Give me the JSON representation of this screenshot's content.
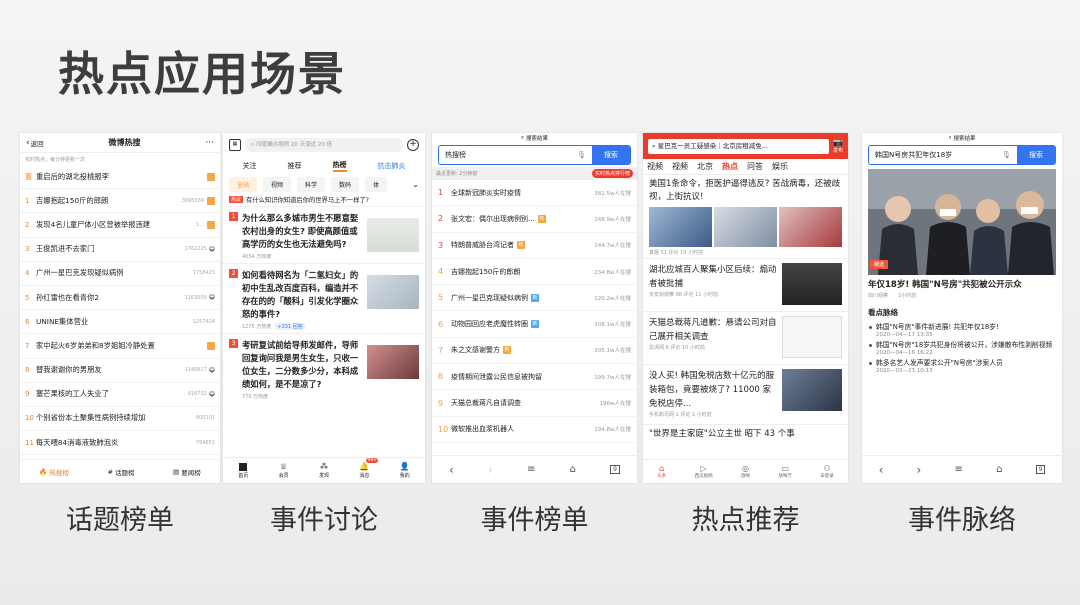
{
  "slide_title": "热点应用场景",
  "captions": [
    "话题榜单",
    "事件讨论",
    "事件榜单",
    "热点推荐",
    "事件脉络"
  ],
  "accent_colors": {
    "weibo": "#f2831f",
    "baidu": "#3375f1",
    "news_red": "#eb3c2b"
  },
  "weibo": {
    "back_label": "返回",
    "title": "微博热搜",
    "subtitle": "实时热点，每分钟更新一次",
    "items": [
      {
        "rank": "置",
        "title": "重启后的湖北投桃报李",
        "heat": "",
        "tag": true
      },
      {
        "rank": "1",
        "title": "吉娜抱起150斤的郎朗",
        "heat": "3095569",
        "tag": true
      },
      {
        "rank": "2",
        "title": "发现4名儿童尸体小区曾被举报违建",
        "heat": "1...",
        "tag": true
      },
      {
        "rank": "3",
        "title": "王俊凯进不去家门",
        "heat": "1762225",
        "tag": false,
        "emoji": "😄"
      },
      {
        "rank": "4",
        "title": "广州一星巴克发现疑似病例",
        "heat": "1758423",
        "tag": false
      },
      {
        "rank": "5",
        "title": "孙红雷也在看青你2",
        "heat": "1263059",
        "tag": false,
        "emoji": "😄"
      },
      {
        "rank": "6",
        "title": "UNINE集体营业",
        "heat": "1257424",
        "tag": false
      },
      {
        "rank": "7",
        "title": "家中起火6岁弟弟和8岁姐姐冷静处置",
        "heat": "",
        "tag": true
      },
      {
        "rank": "8",
        "title": "替我谢谢你的男朋友",
        "heat": "1140817",
        "tag": false,
        "emoji": "😄"
      },
      {
        "rank": "9",
        "title": "塞芒果核的工人失业了",
        "heat": "916732",
        "tag": false,
        "emoji": "😄"
      },
      {
        "rank": "10",
        "title": "个别省份本土聚集性病例持续增加",
        "heat": "800101",
        "tag": false
      },
      {
        "rank": "11",
        "title": "每天喂84消毒液致肺泡炎",
        "heat": "764651",
        "tag": false
      }
    ],
    "footer": [
      "热搜榜",
      "话题榜",
      "要闻榜"
    ]
  },
  "zhihu": {
    "search_placeholder": "印度确诊病例 20 天涨近 20 倍",
    "tabs": [
      "关注",
      "推荐",
      "热榜",
      "抗击肺炎"
    ],
    "active_tab": "热榜",
    "chips": [
      "全站",
      "视频",
      "科学",
      "数码",
      "体"
    ],
    "question_tag": "热议",
    "question": "有什么知识你知道后你的世界马上不一样了?",
    "items": [
      {
        "rank": "1",
        "title": "为什么那么多城市男生不愿意娶农村出身的女生? 即使高颜值或高学历的女生也无法避免吗?",
        "meta": "4054 万热度",
        "extra": ""
      },
      {
        "rank": "2",
        "title": "如何看待网名为「二氢妇女」的初中生乱改百度百科，编造并不存在的的「酸科」引发化学圈众怒的事件?",
        "meta": "1275 万热度",
        "extra": "+331 回答"
      },
      {
        "rank": "3",
        "title": "考研复试前给导师发邮件，导师回复询问我是男生女生，只收一位女生，二分数多少分，本科成绩如何，是不是凉了?",
        "meta": "770 万热度",
        "extra": ""
      }
    ],
    "footer": [
      "首页",
      "会员",
      "发现",
      "消息",
      "我的"
    ],
    "badge": "99+"
  },
  "baidu": {
    "status_title": "搜索结果",
    "query": "热搜榜",
    "search_btn": "搜索",
    "updated": "最近更新: 2分钟前",
    "realtime": "实时热点排行榜",
    "items": [
      {
        "rank": "1",
        "title": "全球新冠肺炎实时疫情",
        "heat": "381.5w人在搜",
        "badge": "",
        "color": ""
      },
      {
        "rank": "2",
        "title": "张文宏：偶尔出现病例别...",
        "heat": "248.9w人在搜",
        "badge": "热",
        "color": "#f4a43a"
      },
      {
        "rank": "3",
        "title": "特朗普威胁台湾记者",
        "heat": "244.7w人在搜",
        "badge": "热",
        "color": "#f4a43a"
      },
      {
        "rank": "4",
        "title": "吉娜抱起150斤的郎朗",
        "heat": "234.8w人在搜",
        "badge": "",
        "color": ""
      },
      {
        "rank": "5",
        "title": "广州一星巴克现疑似病例",
        "heat": "220.2w人在搜",
        "badge": "新",
        "color": "#4ca9f0"
      },
      {
        "rank": "6",
        "title": "动物园回应老虎魔性转圈",
        "heat": "208.1w人在搜",
        "badge": "新",
        "color": "#4ca9f0"
      },
      {
        "rank": "7",
        "title": "朱之文感谢警方",
        "heat": "205.1w人在搜",
        "badge": "热",
        "color": "#f4a43a"
      },
      {
        "rank": "8",
        "title": "疫情期间泄露公民信息被拘留",
        "heat": "199.7w人在搜",
        "badge": "",
        "color": ""
      },
      {
        "rank": "9",
        "title": "天猫总裁蒋凡自请调查",
        "heat": "196w人在搜",
        "badge": "",
        "color": ""
      },
      {
        "rank": "10",
        "title": "微软推出血浆机器人",
        "heat": "194.8w人在搜",
        "badge": "",
        "color": ""
      }
    ]
  },
  "toutiao": {
    "search_text": "星巴克一员工疑感染｜北京房租减免...",
    "publish": "发布",
    "nav": [
      "视频",
      "视频",
      "北京",
      "热点",
      "问答",
      "娱乐"
    ],
    "active_nav": "热点",
    "lead": {
      "title": "美国1条命令，拒医护逼得逃反? 苦战病毒，还被歧视，上街抗议!",
      "meta": "真晨  51 评论  10 小时前"
    },
    "items": [
      {
        "title": "湖北应城百人聚集小区后续：煽动者被批捕",
        "meta": "长安剑观察  98 评论  11 小时前"
      },
      {
        "title": "天猫总裁蒋凡道歉：悬请公司对自己展开相关调查",
        "meta": "澎湃网  8 评论  10 小时前"
      },
      {
        "title": "没人买! 韩国免税店数十亿元的服装箱包，竟要被烧了? 11000 家免税店停...",
        "meta": "手机和讯网  1 评论  1 小时前"
      },
      {
        "title": "\"世界是主家庭\"公立主世  昭下 43 个事",
        "meta": ""
      }
    ],
    "footer": [
      "头条",
      "西瓜视频",
      "放映",
      "放映厅",
      "未登录"
    ]
  },
  "event": {
    "status_title": "搜索结果",
    "query": "韩国N号房共犯年仅18岁",
    "search_btn": "搜索",
    "badge": "精选",
    "headline": "年仅18岁! 韩国\"N号房\"共犯被公开示众",
    "source": "四川观察",
    "time": "3小时前",
    "timeline_title": "看点脉络",
    "events": [
      {
        "title": "韩国\"N号房\"事件新进展! 共犯年仅18岁!",
        "date": "2020—04—17 13:35"
      },
      {
        "title": "韩国\"N号房\"18岁共犯身份将被公开，涉嫌散布性剥削视频",
        "date": "2020—04—16 16:22"
      },
      {
        "title": "韩多名艺人发声要求公开\"N号房\"涉案人员",
        "date": "2020—03—23 10:13"
      }
    ]
  }
}
